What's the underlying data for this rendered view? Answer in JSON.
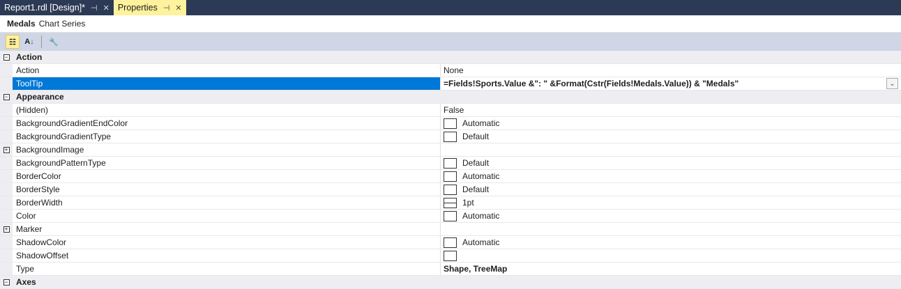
{
  "tabs": [
    {
      "label": "Report1.rdl [Design]*"
    },
    {
      "label": "Properties"
    }
  ],
  "object": {
    "name": "Medals",
    "type": "Chart Series"
  },
  "toolbar": {
    "categorized": "categorized-icon",
    "alphabetical": "sort-az-icon",
    "property_pages": "wrench-icon"
  },
  "categories": {
    "action": "Action",
    "appearance": "Appearance",
    "axes": "Axes"
  },
  "action_rows": [
    {
      "name": "Action",
      "value": "None"
    },
    {
      "name": "ToolTip",
      "value": "=Fields!Sports.Value &\": \" &Format(Cstr(Fields!Medals.Value)) & \"Medals\""
    }
  ],
  "appearance_rows": [
    {
      "name": "(Hidden)",
      "value": "False"
    },
    {
      "name": "BackgroundGradientEndColor",
      "value": "Automatic"
    },
    {
      "name": "BackgroundGradientType",
      "value": "Default"
    },
    {
      "name": "BackgroundImage",
      "value": ""
    },
    {
      "name": "BackgroundPatternType",
      "value": "Default"
    },
    {
      "name": "BorderColor",
      "value": "Automatic"
    },
    {
      "name": "BorderStyle",
      "value": "Default"
    },
    {
      "name": "BorderWidth",
      "value": "1pt"
    },
    {
      "name": "Color",
      "value": "Automatic"
    },
    {
      "name": "Marker",
      "value": ""
    },
    {
      "name": "ShadowColor",
      "value": "Automatic"
    },
    {
      "name": "ShadowOffset",
      "value": ""
    },
    {
      "name": "Type",
      "value": "Shape, TreeMap"
    }
  ]
}
